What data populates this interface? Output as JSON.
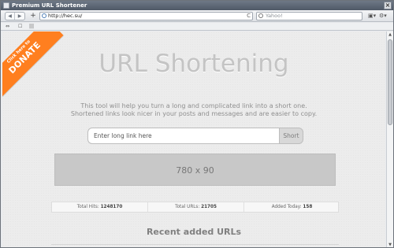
{
  "window": {
    "title": "Premium URL Shortener",
    "close": "×"
  },
  "toolbar": {
    "back": "◀",
    "forward": "▶",
    "plus": "+",
    "url": "http://hec.su/",
    "search_placeholder": "Yahoo!",
    "page_menu": "▣▾",
    "tools_menu": "⚙▾",
    "reload": "C"
  },
  "subbar": {
    "icon_1": "⇔",
    "icon_2": "☐",
    "icon_3": "|||"
  },
  "donate": {
    "small": "Click here to",
    "big": "DONATE"
  },
  "page": {
    "title": "URL Shortening",
    "description_line_1": "This tool will help you turn a long and complicated link into a short one.",
    "description_line_2": "Shortened links look nicer in your posts and messages and are easier to copy.",
    "input_placeholder": "Enter long link here",
    "button_label": "Short",
    "ad_text": "780 x 90",
    "stats": [
      {
        "label": "Total Hits:",
        "value": "1248170"
      },
      {
        "label": "Total URLs:",
        "value": "21705"
      },
      {
        "label": "Added Today:",
        "value": "158"
      }
    ],
    "recent_title": "Recent added URLs"
  },
  "scrollbar": {
    "up": "▲",
    "down": "▼"
  },
  "colors": {
    "accent": "#ff7f1f",
    "titlebar": "#5a6472"
  }
}
